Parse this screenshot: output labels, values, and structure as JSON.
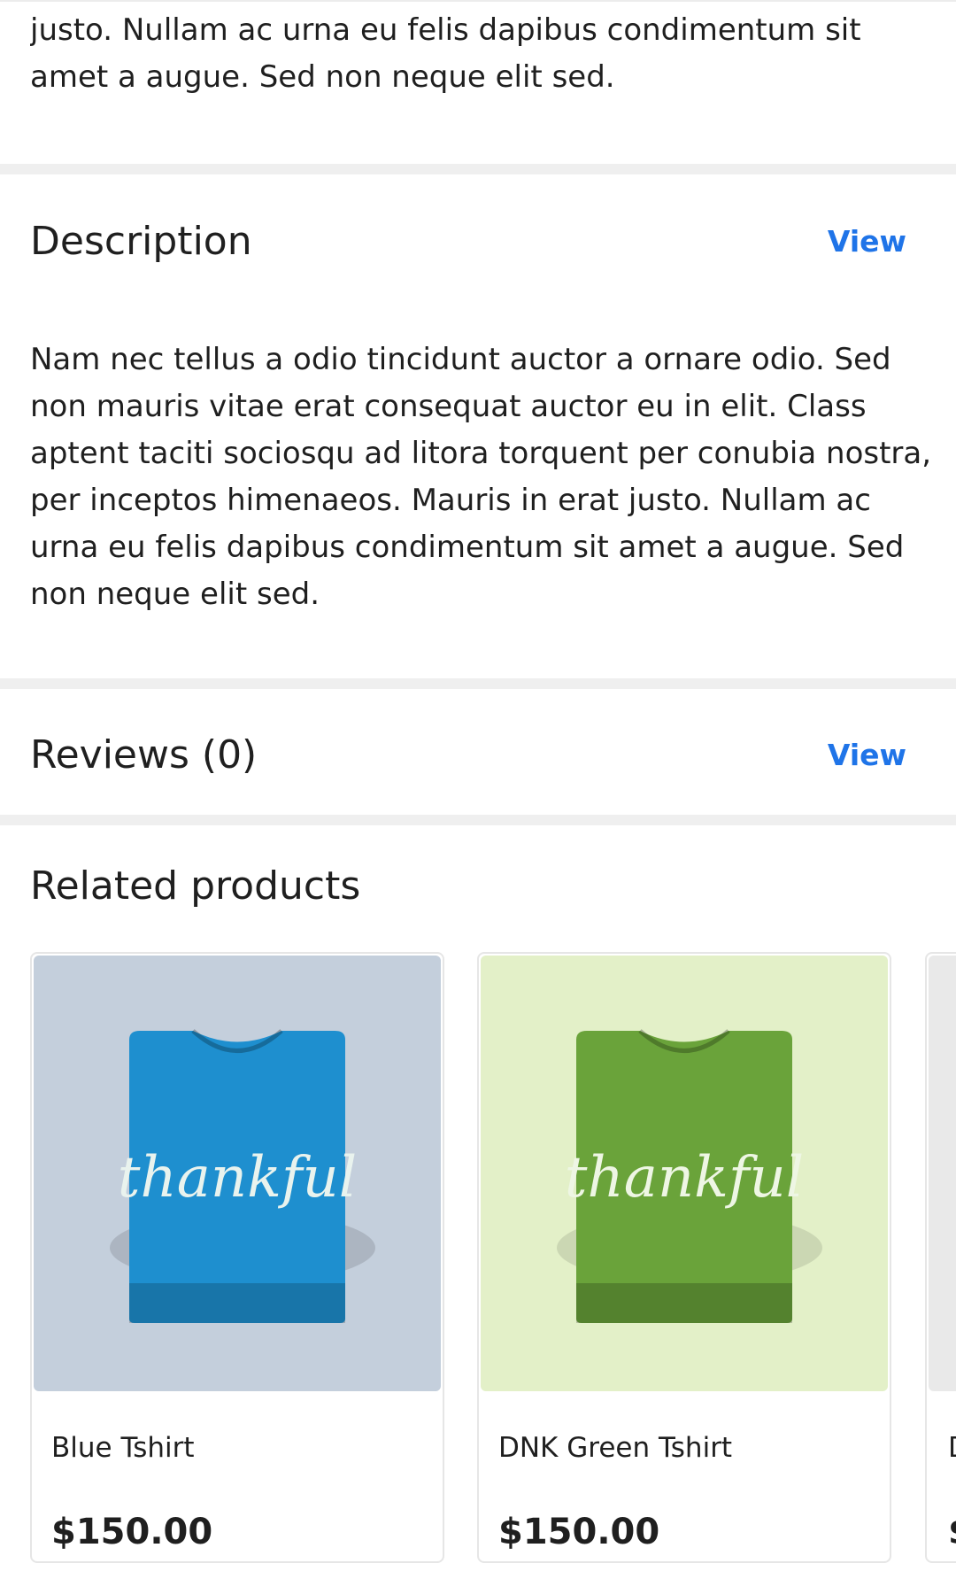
{
  "short_description": {
    "text": "justo. Nullam ac urna eu felis dapibus condimentum sit amet a augue. Sed non neque elit sed."
  },
  "description": {
    "title": "Description",
    "view_label": "View",
    "body": "Nam nec tellus a odio tincidunt auctor a ornare odio. Sed non mauris vitae erat consequat auctor eu in elit. Class aptent taciti sociosqu ad litora torquent per conubia nostra, per inceptos himenaeos. Mauris in erat justo. Nullam ac urna eu felis dapibus condimentum sit amet a augue. Sed non neque elit sed."
  },
  "reviews": {
    "title": "Reviews (0)",
    "view_label": "View"
  },
  "related": {
    "title": "Related products",
    "products": [
      {
        "name": "Blue Tshirt",
        "price": "$150.00",
        "shirt_color": "#1e8fcf",
        "bg_color": "#c4cfdc",
        "print_text": "thankful"
      },
      {
        "name": "DNK Green Tshirt",
        "price": "$150.00",
        "shirt_color": "#6aa33a",
        "bg_color": "#e3f0c8",
        "print_text": "thankful"
      }
    ]
  }
}
